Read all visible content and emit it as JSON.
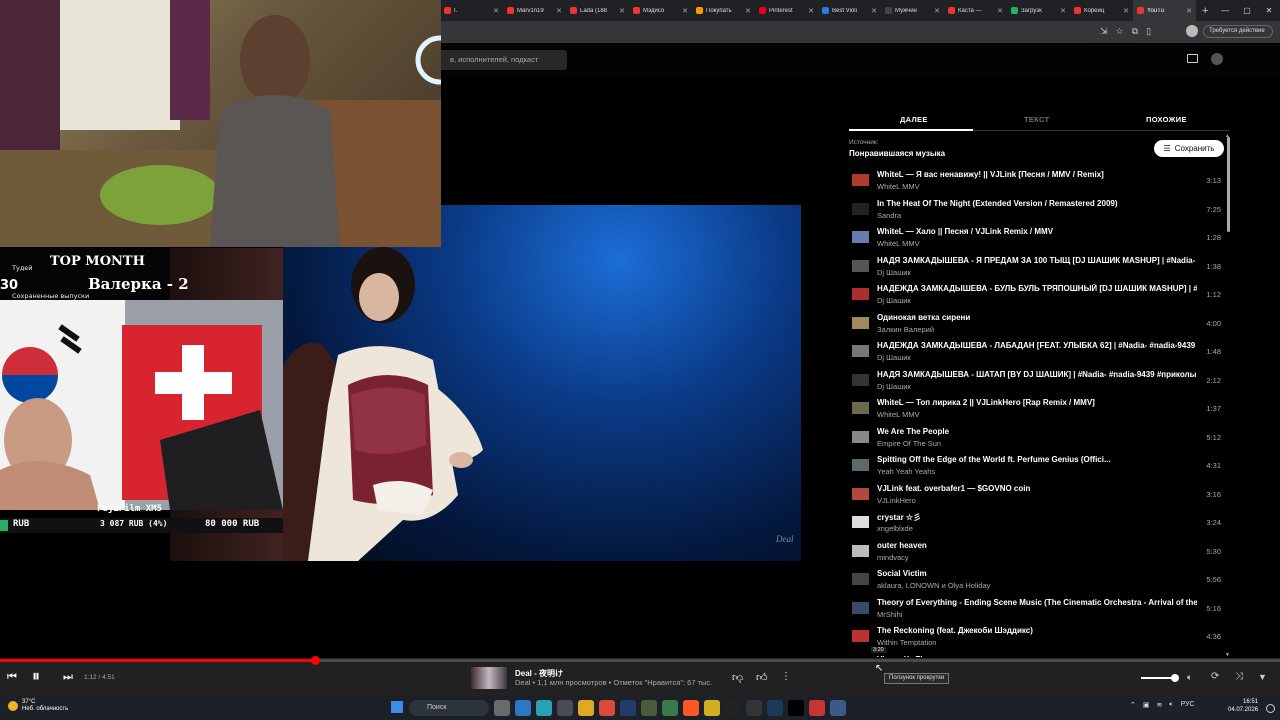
{
  "browser": {
    "tabs": [
      {
        "label": "I.",
        "active": false
      },
      {
        "label": "Marv1n19",
        "active": false
      },
      {
        "label": "Lada (188",
        "active": false
      },
      {
        "label": "Мэдисо",
        "active": false
      },
      {
        "label": "Покупать",
        "active": false
      },
      {
        "label": "Pinterest",
        "active": false
      },
      {
        "label": "Best Violi",
        "active": false
      },
      {
        "label": "Мужчин",
        "active": false
      },
      {
        "label": "Каста —",
        "active": false
      },
      {
        "label": "Загрузк",
        "active": false
      },
      {
        "label": "Корейц",
        "active": false
      },
      {
        "label": "YouTu",
        "active": true
      }
    ],
    "update_button": "Требуется действие"
  },
  "header": {
    "search_placeholder": "в, исполнителей, подкаст"
  },
  "panel": {
    "tabs": [
      "ДАЛЕЕ",
      "ТЕКСТ",
      "ПОХОЖИЕ"
    ],
    "source_label": "Источник:",
    "source_name": "Понравившаяся музыка",
    "save_label": "Сохранить"
  },
  "queue": [
    {
      "title": "WhiteL — Я вас ненавижу! || VJLink [Песня / MMV / Remix]",
      "artist": "WhiteL MMV",
      "duration": "3:13"
    },
    {
      "title": "In The Heat Of The Night (Extended Version / Remastered 2009)",
      "artist": "Sandra",
      "duration": "7:25"
    },
    {
      "title": "WhiteL — Хало || Песня / VJLink Remix / MMV",
      "artist": "WhiteL MMV",
      "duration": "1:28"
    },
    {
      "title": "НАДЯ ЗАМКАДЫШЕВА - Я ПРЕДАМ ЗА 100 ТЫЩ [DJ ШАШИК MASHUP] | #Nadia- #...",
      "artist": "Dj Шашик",
      "duration": "1:38"
    },
    {
      "title": "НАДЕЖДА ЗАМКАДЫШЕВА - БУЛЬ БУЛЬ ТРЯПОШНЫЙ [DJ ШАШИК MASHUP] | #N...",
      "artist": "Dj Шашик",
      "duration": "1:12"
    },
    {
      "title": "Одинокая ветка сирени",
      "artist": "Залкин Валерий",
      "duration": "4:00"
    },
    {
      "title": "НАДЕЖДА ЗАМКАДЫШЕВА - ЛАБАДАН [FEAT. УЛЫБКА 62] | #Nadia- #nadia-9439 ...",
      "artist": "Dj Шашик",
      "duration": "1:48"
    },
    {
      "title": "НАДЯ ЗАМКАДЫШЕВА - ШАТАП [BY DJ ШАШИК] | #Nadia- #nadia-9439 #приколы ...",
      "artist": "Dj Шашик",
      "duration": "2:12"
    },
    {
      "title": "WhiteL — Топ лирика 2 || VJLinkHero [Rap Remix / MMV]",
      "artist": "WhiteL MMV",
      "duration": "1:37"
    },
    {
      "title": "We Are The People",
      "artist": "Empire Of The Sun",
      "duration": "5:12"
    },
    {
      "title": "Spitting Off the Edge of the World ft. Perfume Genius (Offici...",
      "artist": "Yeah Yeah Yeahs",
      "duration": "4:31"
    },
    {
      "title": "VJLink feat. overbafer1 — $GOVNO coin",
      "artist": "VJLinkHero",
      "duration": "3:16"
    },
    {
      "title": "crystar ☆彡",
      "artist": "xngelblxde",
      "duration": "3:24"
    },
    {
      "title": "outer heaven",
      "artist": "mindvacy",
      "duration": "5:30"
    },
    {
      "title": "Social Victim",
      "artist": "aklaura, LONOWN и Olya Holiday",
      "duration": "5:56"
    },
    {
      "title": "Theory of Everything - Ending Scene Music (The Cinematic Orchestra - Arrival of the bir...",
      "artist": "MrShihi",
      "duration": "5:16"
    },
    {
      "title": "The Reckoning (feat. Джекоби Шэддикс)",
      "artist": "Within Temptation",
      "duration": "4:36"
    },
    {
      "title": "Virus - Ya Zhavu",
      "artist": "",
      "duration": ""
    }
  ],
  "player": {
    "time": "1:12 / 4:51",
    "progress_fraction": 0.246,
    "now_playing_title": "Deal - 夜明け",
    "now_playing_sub": "Deal • 1,1 млн просмотров • Отметок \"Нравится\": 67 тыс.",
    "tooltip": "Ползунок прокрутки",
    "seek_hover_time": "3:20"
  },
  "video": {
    "watermark": "Deal"
  },
  "stream_overlay": {
    "top_month": "TOP MONTH",
    "name_banner": "Валерка - 2",
    "left_num": "30",
    "small_1": "Тудей",
    "small_2": "Сохраненные выпуски",
    "camera": "FujiFilm XM5",
    "rub_left": "RUB",
    "rub_mid": "3 087 RUB (4%)",
    "rub_right": "80 000 RUB"
  },
  "taskbar": {
    "weather_temp": "37°C",
    "weather_desc": "Неб. облачность",
    "search_label": "Поиск",
    "lang": "РУС",
    "time": "16:51",
    "date": "04.07.2026"
  }
}
